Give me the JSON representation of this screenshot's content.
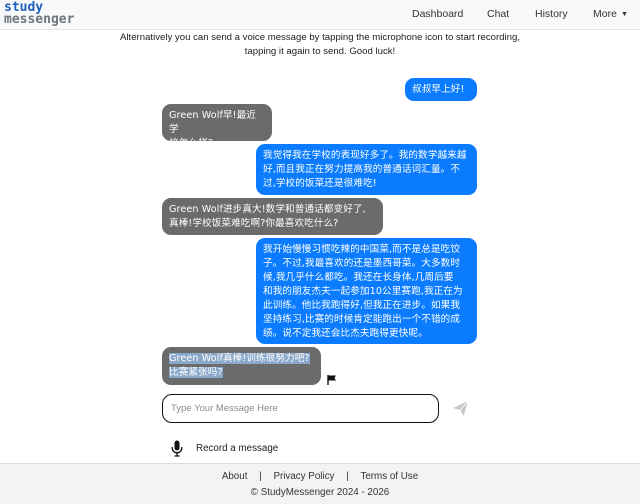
{
  "header": {
    "logo_line1": "study",
    "logo_line2": "messenger",
    "nav": {
      "dashboard": "Dashboard",
      "chat": "Chat",
      "history": "History",
      "more": "More"
    }
  },
  "intro": {
    "line1": "Alternatively you can send a voice message by tapping the microphone icon to start recording,",
    "line2": "tapping it again to send. Good luck!"
  },
  "messages": [
    {
      "from": "user",
      "lines": [
        "叔叔早上好!"
      ]
    },
    {
      "from": "bot",
      "lines": [
        "Green Wolf早!最近学",
        "校怎么样?"
      ]
    },
    {
      "from": "user",
      "lines": [
        "我觉得我在学校的表现好多了。我的数学越来越",
        "好,而且我正在努力提高我的普通话词汇量。不",
        "过,学校的饭菜还是很难吃!"
      ]
    },
    {
      "from": "bot",
      "lines": [
        "Green Wolf进步真大!数学和普通话都变好了,",
        "真棒!学校饭菜难吃啊?你最喜欢吃什么?"
      ]
    },
    {
      "from": "user",
      "lines": [
        "我开始慢慢习惯吃辣的中国菜,而不是总是吃饺",
        "子。不过,我最喜欢的还是墨西哥菜。大多数时",
        "候,我几乎什么都吃。我还在长身体,几周后要",
        "和我的朋友杰夫一起参加10公里赛跑,我正在为",
        "此训练。他比我跑得好,但我正在进步。如果我",
        "坚持练习,比赛的时候肯定能跑出一个不错的成",
        "绩。说不定我还会比杰夫跑得更快呢。"
      ]
    },
    {
      "from": "bot",
      "lines": [
        "Green Wolf真棒!训练很努力吧?",
        "比赛紧张吗?"
      ]
    }
  ],
  "composer": {
    "placeholder": "Type Your Message Here",
    "record_label": "Record a message"
  },
  "footer": {
    "about": "About",
    "privacy": "Privacy Policy",
    "terms": "Terms of Use",
    "separator": "|",
    "copyright": "© StudyMessenger 2024 - 2026"
  },
  "colors": {
    "sent_bubble": "#0b7cff",
    "received_bubble": "#6b6b6b"
  }
}
